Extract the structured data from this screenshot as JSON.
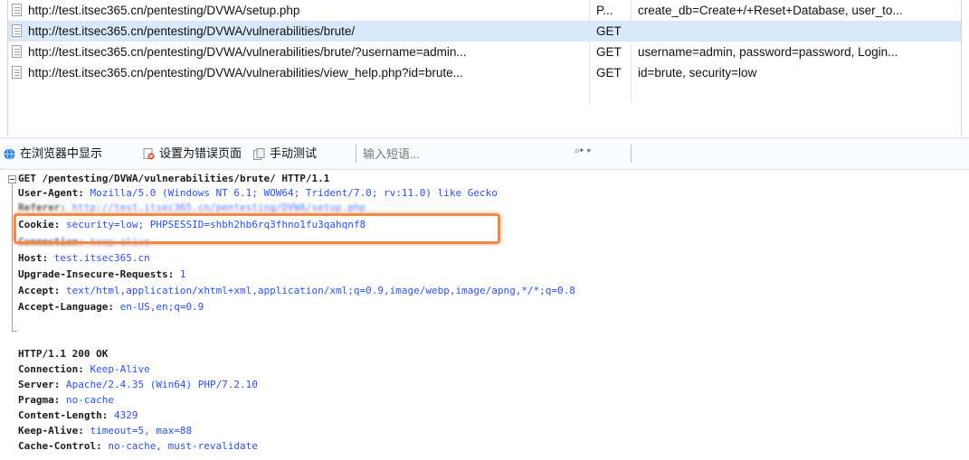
{
  "requests": [
    {
      "url": "http://test.itsec365.cn/pentesting/DVWA/setup.php",
      "method": "P...",
      "params": "create_db=Create+/+Reset+Database, user_to..."
    },
    {
      "url": "http://test.itsec365.cn/pentesting/DVWA/vulnerabilities/brute/",
      "method": "GET",
      "params": ""
    },
    {
      "url": "http://test.itsec365.cn/pentesting/DVWA/vulnerabilities/brute/?username=admin...",
      "method": "GET",
      "params": "username=admin, password=password, Login..."
    },
    {
      "url": "http://test.itsec365.cn/pentesting/DVWA/vulnerabilities/view_help.php?id=brute...",
      "method": "GET",
      "params": "id=brute, security=low"
    }
  ],
  "toolbar": {
    "show_in_browser": "在浏览器中显示",
    "set_error_page": "设置为错误页面",
    "manual_test": "手动测试",
    "search_placeholder": "输入短语...",
    "search_opts": "⌕▸ ▾"
  },
  "request_raw": {
    "request_line": "GET /pentesting/DVWA/vulnerabilities/brute/ HTTP/1.1",
    "headers": [
      {
        "key": "User-Agent",
        "value": "Mozilla/5.0 (Windows NT 6.1; WOW64; Trident/7.0; rv:11.0) like Gecko"
      },
      {
        "key": "Referer",
        "value": "http://test.itsec365.cn/pentesting/DVWA/setup.php"
      },
      {
        "key": "Cookie",
        "value": "security=low; PHPSESSID=shbh2hb6rq3fhno1fu3qahqnf8"
      },
      {
        "key": "Connection",
        "value": "keep-alive"
      },
      {
        "key": "Host",
        "value": "test.itsec365.cn"
      },
      {
        "key": "Upgrade-Insecure-Requests",
        "value": "1"
      },
      {
        "key": "Accept",
        "value": "text/html,application/xhtml+xml,application/xml;q=0.9,image/webp,image/apng,*/*;q=0.8"
      },
      {
        "key": "Accept-Language",
        "value": "en-US,en;q=0.9"
      }
    ]
  },
  "response_raw": {
    "status_line": "HTTP/1.1 200 OK",
    "headers": [
      {
        "key": "Connection",
        "value": "Keep-Alive"
      },
      {
        "key": "Server",
        "value": "Apache/2.4.35 (Win64) PHP/7.2.10"
      },
      {
        "key": "Pragma",
        "value": "no-cache"
      },
      {
        "key": "Content-Length",
        "value": "4329"
      },
      {
        "key": "Keep-Alive",
        "value": "timeout=5, max=88"
      },
      {
        "key": "Cache-Control",
        "value": "no-cache, must-revalidate"
      }
    ]
  },
  "colors": {
    "selected_row": "#d9e9fb",
    "header_value": "#2a4fff",
    "highlight_box": "#f08a4b"
  }
}
